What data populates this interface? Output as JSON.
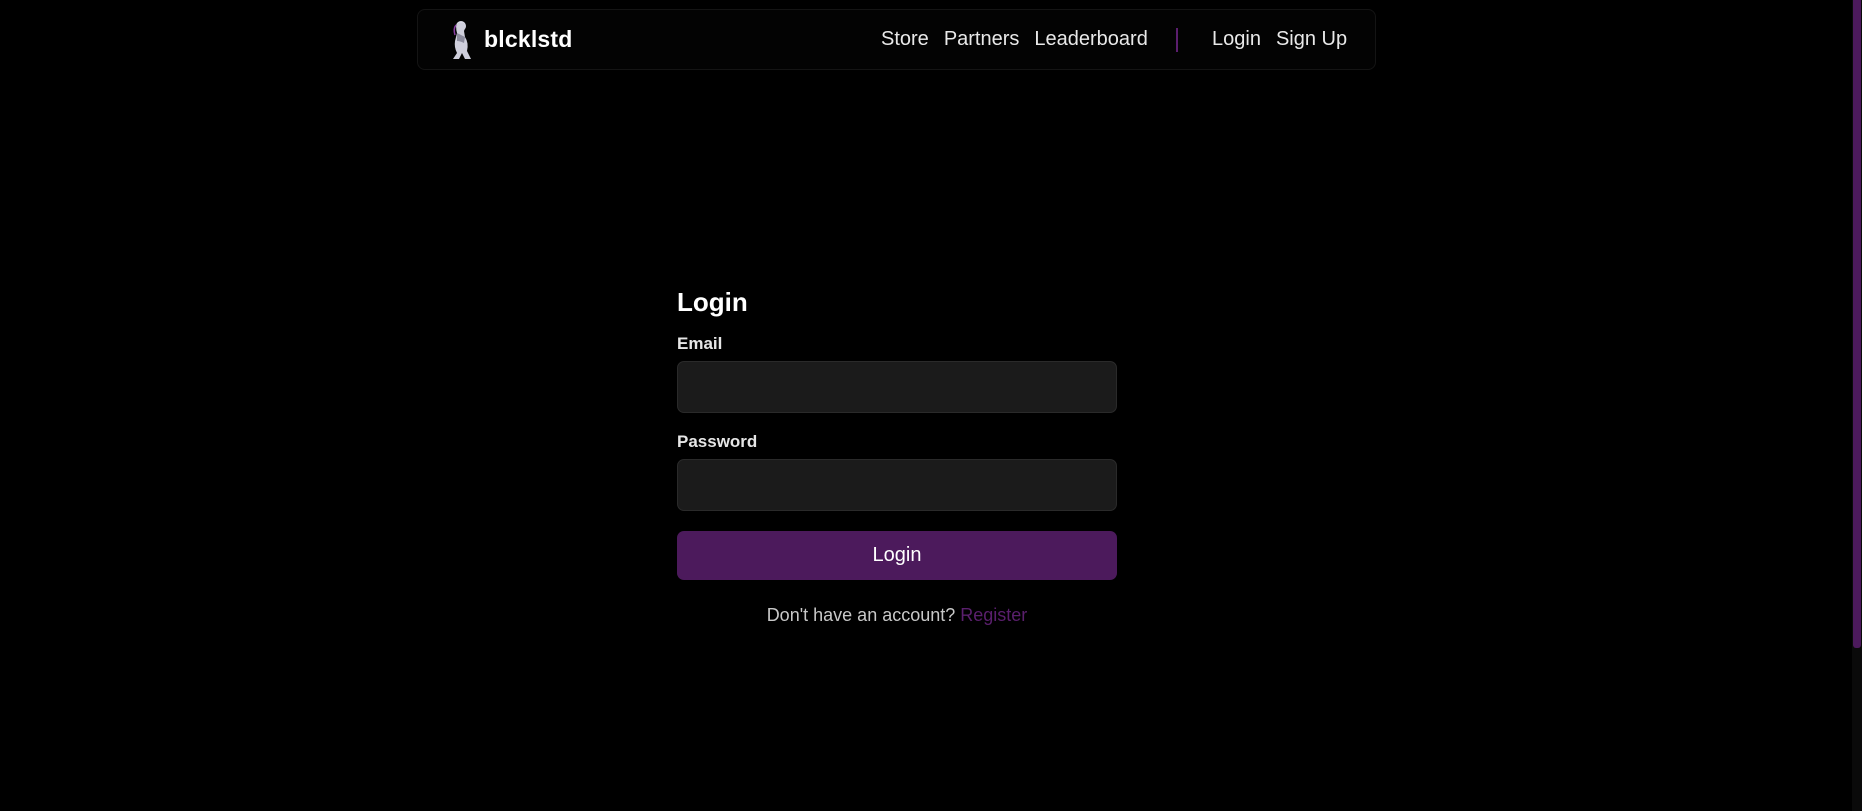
{
  "brand": {
    "name": "blcklstd",
    "logo_icon": "kneeling-figure-logo-icon"
  },
  "nav": {
    "links": [
      {
        "label": "Store"
      },
      {
        "label": "Partners"
      },
      {
        "label": "Leaderboard"
      }
    ],
    "auth": {
      "login_label": "Login",
      "signup_label": "Sign Up"
    }
  },
  "form": {
    "title": "Login",
    "email_label": "Email",
    "email_value": "",
    "password_label": "Password",
    "password_value": "",
    "submit_label": "Login",
    "register_prompt": "Don't have an account?",
    "register_link": "Register"
  },
  "colors": {
    "background": "#000000",
    "accent": "#4c1a5c",
    "link": "#5a1f6d",
    "input_bg": "#1b1b1b"
  }
}
